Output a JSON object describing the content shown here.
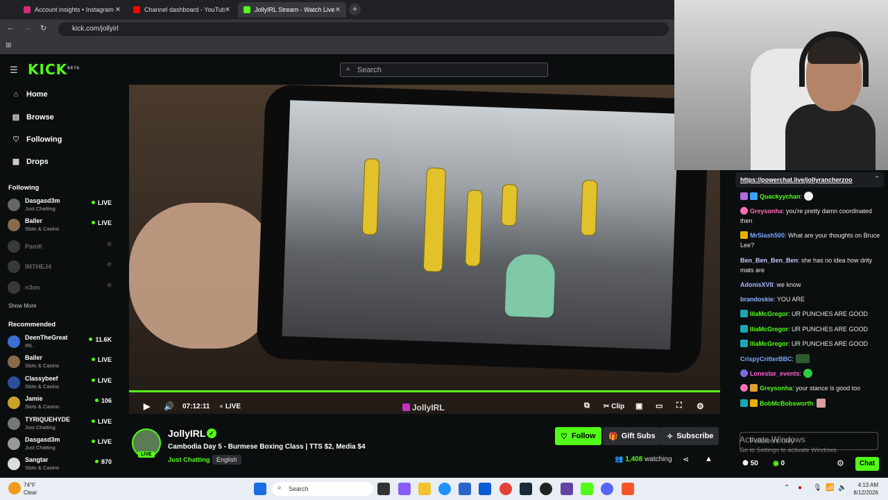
{
  "browser": {
    "tabs": [
      {
        "label": "Account insights • Instagram",
        "color": "#d62976"
      },
      {
        "label": "Channel dashboard - YouTube",
        "color": "#ff0000"
      },
      {
        "label": "JollyIRL Stream - Watch Live on",
        "color": "#53fc18"
      }
    ],
    "url": "kick.com/jollyirl"
  },
  "kick": {
    "logo": "KICK",
    "beta": "BETA",
    "search_placeholder": "Search",
    "nav": [
      "Home",
      "Browse",
      "Following",
      "Drops"
    ],
    "following_header": "Following",
    "following": [
      {
        "name": "Dasgasd3m",
        "category": "Just Chatting",
        "status": "LIVE",
        "live": true
      },
      {
        "name": "Baller",
        "category": "Slots & Casino",
        "status": "LIVE",
        "live": true
      },
      {
        "name": "PamK",
        "category": "",
        "status": "",
        "live": false
      },
      {
        "name": "IMTHEJ4",
        "category": "",
        "status": "",
        "live": false
      },
      {
        "name": "n3on",
        "category": "",
        "status": "",
        "live": false
      }
    ],
    "show_more": "Show More",
    "recommended_header": "Recommended",
    "recommended": [
      {
        "name": "DeenTheGreat",
        "category": "IRL",
        "status": "11.6K"
      },
      {
        "name": "Baller",
        "category": "Slots & Casino",
        "status": "LIVE"
      },
      {
        "name": "Classybeef",
        "category": "Slots & Casino",
        "status": "LIVE"
      },
      {
        "name": "Jamie",
        "category": "Slots & Casino",
        "status": "106"
      },
      {
        "name": "TYRIQUEHYDE",
        "category": "Just Chatting",
        "status": "LIVE"
      },
      {
        "name": "Dasgasd3m",
        "category": "Just Chatting",
        "status": "LIVE"
      },
      {
        "name": "Sangtar",
        "category": "Slots & Casino",
        "status": "870"
      }
    ]
  },
  "player": {
    "time": "07:12:11",
    "live": "LIVE",
    "clip": "Clip",
    "watermark": "JollyIRL"
  },
  "stream": {
    "name": "JollyIRL",
    "title": "Cambodia Day 5 - Burmese Boxing Class | TTS $2, Media $4",
    "category": "Just Chatting",
    "language": "English",
    "live_badge": "LIVE",
    "follow": "Follow",
    "gift": "Gift Subs",
    "subscribe": "Subscribe",
    "viewers": "1,408",
    "watching": "watching"
  },
  "chat": {
    "pinned_link": "https://powerchat.live/jollyrancherzoo",
    "messages": [
      {
        "user": "Quackyychan",
        "color": "#53fc18",
        "text": ""
      },
      {
        "user": "Greysonha",
        "color": "#ff6fb5",
        "text": "you're pretty damn coordinated then"
      },
      {
        "user": "MrSlash500",
        "color": "#7aa7ff",
        "text": "What are your thoughts on Bruce Lee?"
      },
      {
        "user": "Ben_Ben_Ben_Ben",
        "color": "#c8c8ff",
        "text": "she has no idea how drity mats are"
      },
      {
        "user": "AdonisXVII",
        "color": "#a9b7ff",
        "text": "we know"
      },
      {
        "user": "brandoskie",
        "color": "#8fb1ff",
        "text": "YOU ARE"
      },
      {
        "user": "IliaMcGregor",
        "color": "#53fc18",
        "text": "UR PUNCHES ARE GOOD"
      },
      {
        "user": "IliaMcGregor",
        "color": "#53fc18",
        "text": "UR PUNCHES ARE GOOD"
      },
      {
        "user": "IliaMcGregor",
        "color": "#53fc18",
        "text": "UR PUNCHES ARE GOOD"
      },
      {
        "user": "CrispyCritterBBC",
        "color": "#7aa7ff",
        "text": ""
      },
      {
        "user": "Lonestar_events",
        "color": "#ff5fd2",
        "text": ""
      },
      {
        "user": "Greysonha",
        "color": "#53fc18",
        "text": "your stance is good too"
      },
      {
        "user": "BobMcBobsworth",
        "color": "#53fc18",
        "text": ""
      }
    ],
    "followers_placeholder": "Followers only",
    "activate_title": "Activate Windows",
    "activate_sub": "Go to Settings to activate Windows.",
    "points": "50",
    "kicks": "0",
    "send": "Chat"
  },
  "taskbar": {
    "temp": "74°F",
    "weather": "Clear",
    "search": "Search",
    "time": "4:13 AM",
    "date": "8/12/2026"
  },
  "colors": {
    "accent": "#53fc18",
    "bg": "#0b0e0f"
  }
}
